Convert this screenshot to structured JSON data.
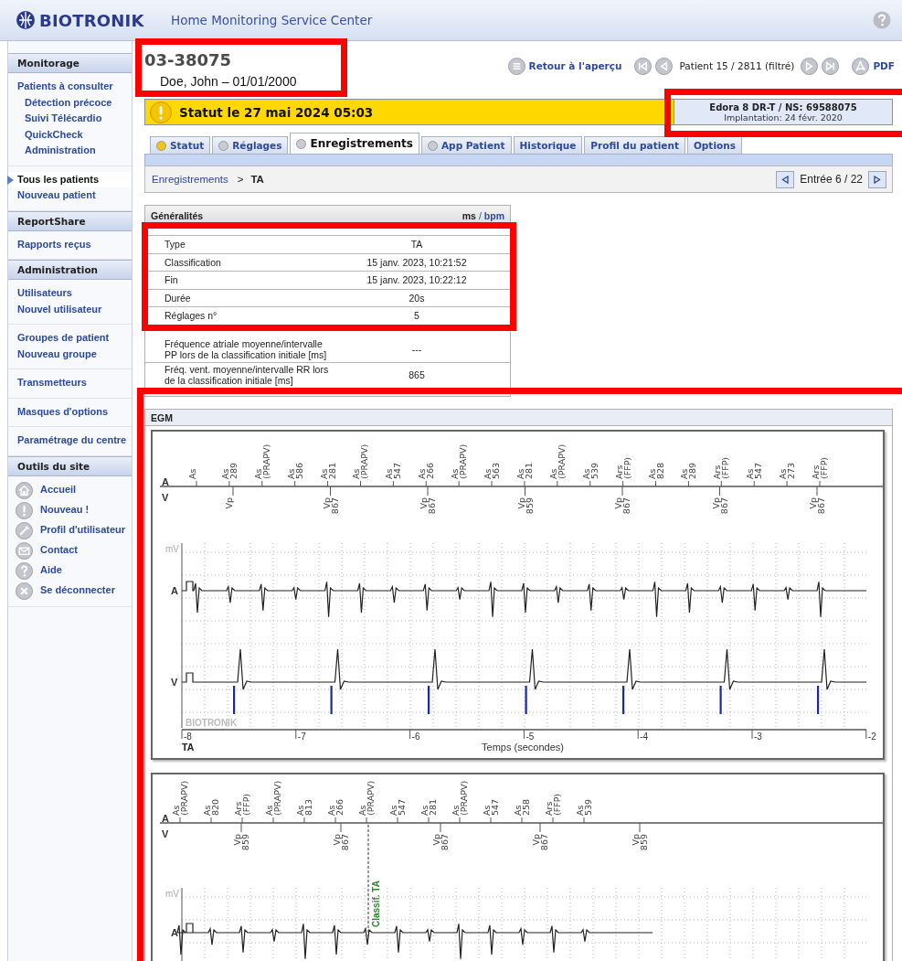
{
  "header": {
    "logo": "BIOTRONIK",
    "title": "Home Monitoring Service Center"
  },
  "sidebar": {
    "sections": [
      {
        "title": "Monitorage",
        "kind": "links",
        "groups": [
          {
            "items": [
              {
                "label": "Patients à consulter",
                "selected": false,
                "children": [
                  {
                    "label": "Détection précoce",
                    "selected": false
                  },
                  {
                    "label": "Suivi Télécardio",
                    "selected": false
                  },
                  {
                    "label": "QuickCheck",
                    "selected": false
                  },
                  {
                    "label": "Administration",
                    "selected": false
                  }
                ]
              }
            ]
          },
          {
            "items": [
              {
                "label": "Tous les patients",
                "selected": true
              },
              {
                "label": "Nouveau patient",
                "selected": false
              }
            ]
          }
        ]
      },
      {
        "title": "ReportShare",
        "kind": "links",
        "groups": [
          {
            "items": [
              {
                "label": "Rapports reçus",
                "selected": false
              }
            ]
          }
        ]
      },
      {
        "title": "Administration",
        "kind": "links",
        "groups": [
          {
            "items": [
              {
                "label": "Utilisateurs",
                "selected": false
              },
              {
                "label": "Nouvel utilisateur",
                "selected": false
              }
            ]
          },
          {
            "items": [
              {
                "label": "Groupes de patient",
                "selected": false
              },
              {
                "label": "Nouveau groupe",
                "selected": false
              }
            ]
          },
          {
            "items": [
              {
                "label": "Transmetteurs",
                "selected": false
              }
            ]
          },
          {
            "items": [
              {
                "label": "Masques d'options",
                "selected": false
              }
            ]
          },
          {
            "items": [
              {
                "label": "Paramétrage du centre",
                "selected": false
              }
            ]
          }
        ]
      },
      {
        "title": "Outils du site",
        "kind": "tools",
        "groups": [
          {
            "items": [
              {
                "label": "Accueil",
                "selected": false
              },
              {
                "label": "Nouveau !",
                "selected": false
              },
              {
                "label": "Profil d'utilisateur",
                "selected": false
              },
              {
                "label": "Contact",
                "selected": false
              },
              {
                "label": "Aide",
                "selected": false
              },
              {
                "label": "Se déconnecter",
                "selected": false
              }
            ]
          }
        ]
      }
    ]
  },
  "patient": {
    "id": "03-38075",
    "name": "Doe, John – 01/01/2000"
  },
  "navigation": {
    "back": "Retour à l'aperçu",
    "position": "Patient 15 / 2811 (filtré)",
    "pdf": "PDF"
  },
  "status": {
    "text": "Statut le 27 mai 2024 05:03",
    "device": "Edora 8 DR-T / NS: 69588075",
    "implant": "Implantation: 24 févr. 2020"
  },
  "tabs": [
    {
      "label": "Statut",
      "selected": false,
      "color": "#f0c419"
    },
    {
      "label": "Réglages",
      "selected": false,
      "color": "#c8ccd4"
    },
    {
      "label": "Enregistrements",
      "selected": true,
      "color": "#c8ccd4"
    },
    {
      "label": "App Patient",
      "selected": false,
      "color": "#c8ccd4"
    },
    {
      "label": "Historique",
      "selected": false
    },
    {
      "label": "Profil du patient",
      "selected": false
    },
    {
      "label": "Options",
      "selected": false
    }
  ],
  "breadcrumb": {
    "link": "Enregistrements",
    "separator": ">",
    "current": "TA",
    "entry": "Entrée 6 / 22"
  },
  "general": {
    "title": "Généralités",
    "unit_ms": "ms",
    "unit_sep": "/",
    "unit_bpm": "bpm",
    "rows": [
      {
        "label": "Type",
        "value": "TA"
      },
      {
        "label": "Classification",
        "value": "15 janv. 2023, 10:21:52"
      },
      {
        "label": "Fin",
        "value": "15 janv. 2023, 10:22:12"
      },
      {
        "label": "Durée",
        "value": "20s"
      },
      {
        "label": "Réglages n°",
        "value": "5"
      },
      {
        "label": "Fréquence atriale moyenne/intervalle PP lors de la classification initiale [ms]",
        "value": "---"
      },
      {
        "label": "Fréq. vent. moyenne/intervalle RR lors de la classification initiale [ms]",
        "value": "865"
      }
    ]
  },
  "egm": {
    "title": "EGM",
    "strips": [
      {
        "marker_rows": [
          "A",
          "V"
        ],
        "a_markers": [
          {
            "label": "As"
          },
          {
            "label": "As",
            "value": "289"
          },
          {
            "label": "As",
            "value": "(PRAPV)"
          },
          {
            "label": "As",
            "value": "586"
          },
          {
            "label": "As",
            "value": "281"
          },
          {
            "label": "As",
            "value": "(PRAPV)"
          },
          {
            "label": "As",
            "value": "547"
          },
          {
            "label": "As",
            "value": "266"
          },
          {
            "label": "As",
            "value": "(PRAPV)"
          },
          {
            "label": "As",
            "value": "563"
          },
          {
            "label": "As",
            "value": "281"
          },
          {
            "label": "As",
            "value": "(PRAPV)"
          },
          {
            "label": "As",
            "value": "539"
          },
          {
            "label": "Ars",
            "value": "(FFP)"
          },
          {
            "label": "As",
            "value": "828"
          },
          {
            "label": "As",
            "value": "289"
          },
          {
            "label": "Ars",
            "value": "(FFP)"
          },
          {
            "label": "As",
            "value": "547"
          },
          {
            "label": "As",
            "value": "273"
          },
          {
            "label": "Ars",
            "value": "(FFP)"
          }
        ],
        "v_markers": [
          {
            "label": "Vp"
          },
          {
            "label": "Vp",
            "value": "867"
          },
          {
            "label": "Vp",
            "value": "867"
          },
          {
            "label": "Vp",
            "value": "859"
          },
          {
            "label": "Vp",
            "value": "867"
          },
          {
            "label": "Vp",
            "value": "867"
          },
          {
            "label": "Vp",
            "value": "867"
          }
        ],
        "unit": "mV",
        "traces": [
          "A",
          "V"
        ],
        "brand": "BIOTRONIK",
        "x_ticks": [
          "-8",
          "-7",
          "-6",
          "-5",
          "-4",
          "-3",
          "-2"
        ],
        "episode": "TA",
        "xlabel": "Temps (secondes)"
      },
      {
        "marker_rows": [
          "A",
          "V"
        ],
        "a_markers": [
          {
            "label": "As",
            "value": "(PRAPV)"
          },
          {
            "label": "As",
            "value": "820"
          },
          {
            "label": "Ars",
            "value": "(FFP)"
          },
          {
            "label": "As",
            "value": "(PRAPV)"
          },
          {
            "label": "As",
            "value": "813"
          },
          {
            "label": "As",
            "value": "266"
          },
          {
            "label": "As",
            "value": "(PRAPV)"
          },
          {
            "label": "As",
            "value": "547"
          },
          {
            "label": "As",
            "value": "281"
          },
          {
            "label": "As",
            "value": "(PRAPV)"
          },
          {
            "label": "As",
            "value": "547"
          },
          {
            "label": "As",
            "value": "258"
          },
          {
            "label": "Ars",
            "value": "(FFP)"
          },
          {
            "label": "As",
            "value": "539"
          }
        ],
        "v_markers": [
          {
            "label": "Vp",
            "value": "859"
          },
          {
            "label": "Vp",
            "value": "867"
          },
          {
            "label": "Vp",
            "value": "867"
          },
          {
            "label": "Vp",
            "value": "867"
          },
          {
            "label": "Vp",
            "value": "859"
          }
        ],
        "unit": "mV",
        "traces": [
          "A"
        ],
        "annotation": "Classif. TA"
      }
    ]
  }
}
